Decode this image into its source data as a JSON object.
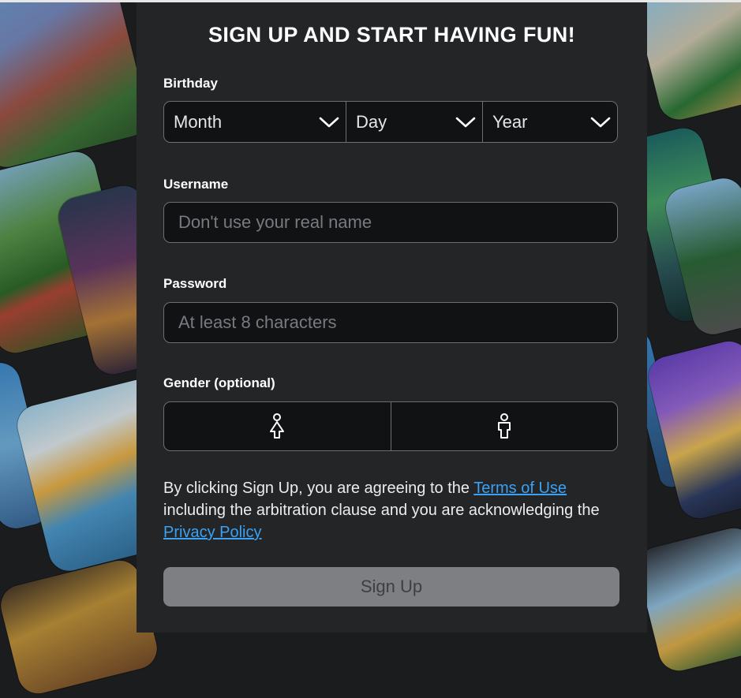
{
  "signup": {
    "title": "SIGN UP AND START HAVING FUN!",
    "birthday": {
      "label": "Birthday",
      "month": "Month",
      "day": "Day",
      "year": "Year"
    },
    "username": {
      "label": "Username",
      "placeholder": "Don't use your real name"
    },
    "password": {
      "label": "Password",
      "placeholder": "At least 8 characters"
    },
    "gender": {
      "label": "Gender (optional)",
      "options": [
        {
          "icon": "female-icon"
        },
        {
          "icon": "male-icon"
        }
      ]
    },
    "terms": {
      "prefix": "By clicking Sign Up, you are agreeing to the ",
      "terms_link": "Terms of Use",
      "middle": " including the arbitration clause and you are acknowledging the ",
      "privacy_link": "Privacy Policy"
    },
    "submit_label": "Sign Up"
  },
  "colors": {
    "card_bg": "#232527",
    "field_bg": "#111214",
    "field_border": "#6b6e73",
    "link": "#3aa2f6",
    "button_bg": "#7e7f82",
    "button_text": "#3d3f43"
  }
}
